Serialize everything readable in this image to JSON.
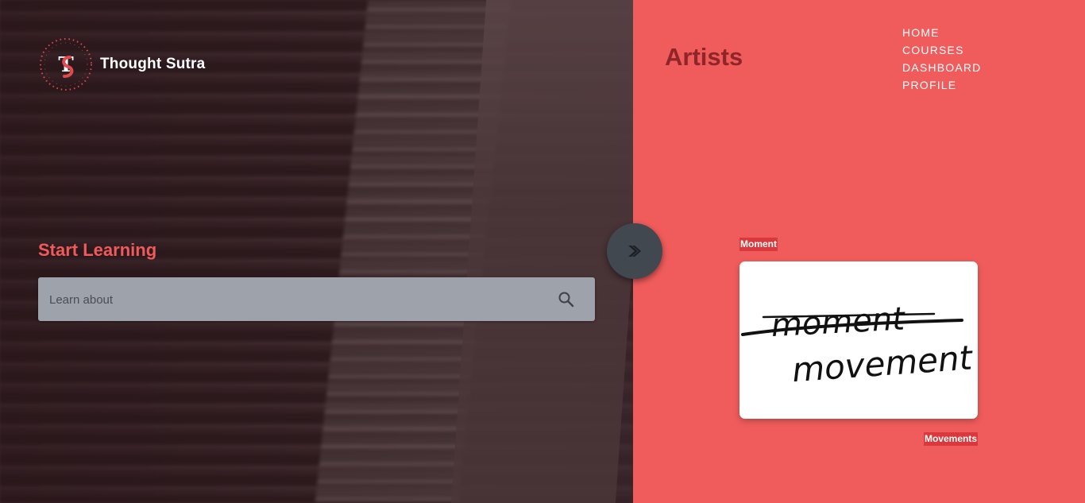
{
  "brand": {
    "name": "Thought Sutra",
    "mark_letter": "TS"
  },
  "hero": {
    "start_title": "Start Learning",
    "search": {
      "placeholder": "Learn about",
      "value": ""
    }
  },
  "panel": {
    "title": "Artists",
    "nav": [
      "HOME",
      "COURSES",
      "DASHBOARD",
      "PROFILE"
    ],
    "card": {
      "label_top": "Moment",
      "label_bottom": "Movements",
      "image_words": [
        "moment",
        "movement"
      ]
    }
  },
  "colors": {
    "accent": "#f05c5b",
    "title_dark": "#8f2528",
    "label_bg": "#d9383c",
    "search_bg": "#9ea2ab",
    "toggle_bg": "#424850"
  },
  "icons": {
    "search": "search-icon",
    "toggle": "double-chevron-right-icon",
    "logo": "thought-sutra-logo-icon"
  }
}
